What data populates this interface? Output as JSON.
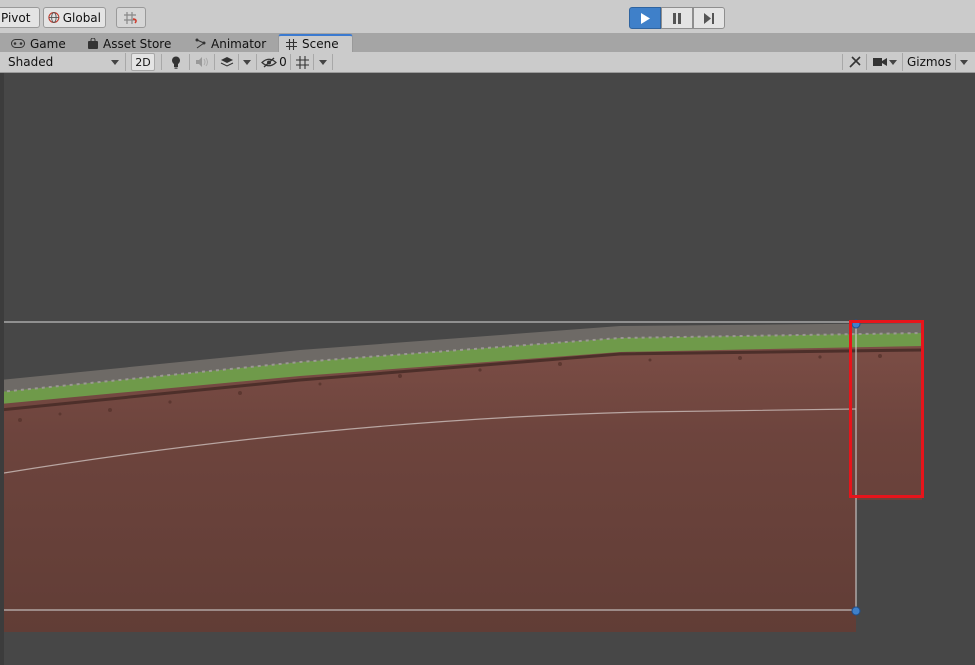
{
  "toolbar": {
    "pivot_label": "Pivot",
    "global_label": "Global"
  },
  "play_controls": [
    "play",
    "pause",
    "step"
  ],
  "tabs": [
    {
      "label": "Game",
      "icon": "gamepad-icon"
    },
    {
      "label": "Asset Store",
      "icon": "shopping-bag-icon"
    },
    {
      "label": "Animator",
      "icon": "animator-icon"
    },
    {
      "label": "Scene",
      "icon": "grid-hash-icon",
      "active": true
    }
  ],
  "scene_toolbar": {
    "shading_mode": "Shaded",
    "mode_2d": "2D",
    "hidden_count": "0",
    "gizmos_label": "Gizmos"
  },
  "colors": {
    "accent": "#3f80c9",
    "dirt": "#653f38",
    "grass": "#6f9a4a",
    "highlight_box": "#e8141b",
    "background": "#474747"
  }
}
